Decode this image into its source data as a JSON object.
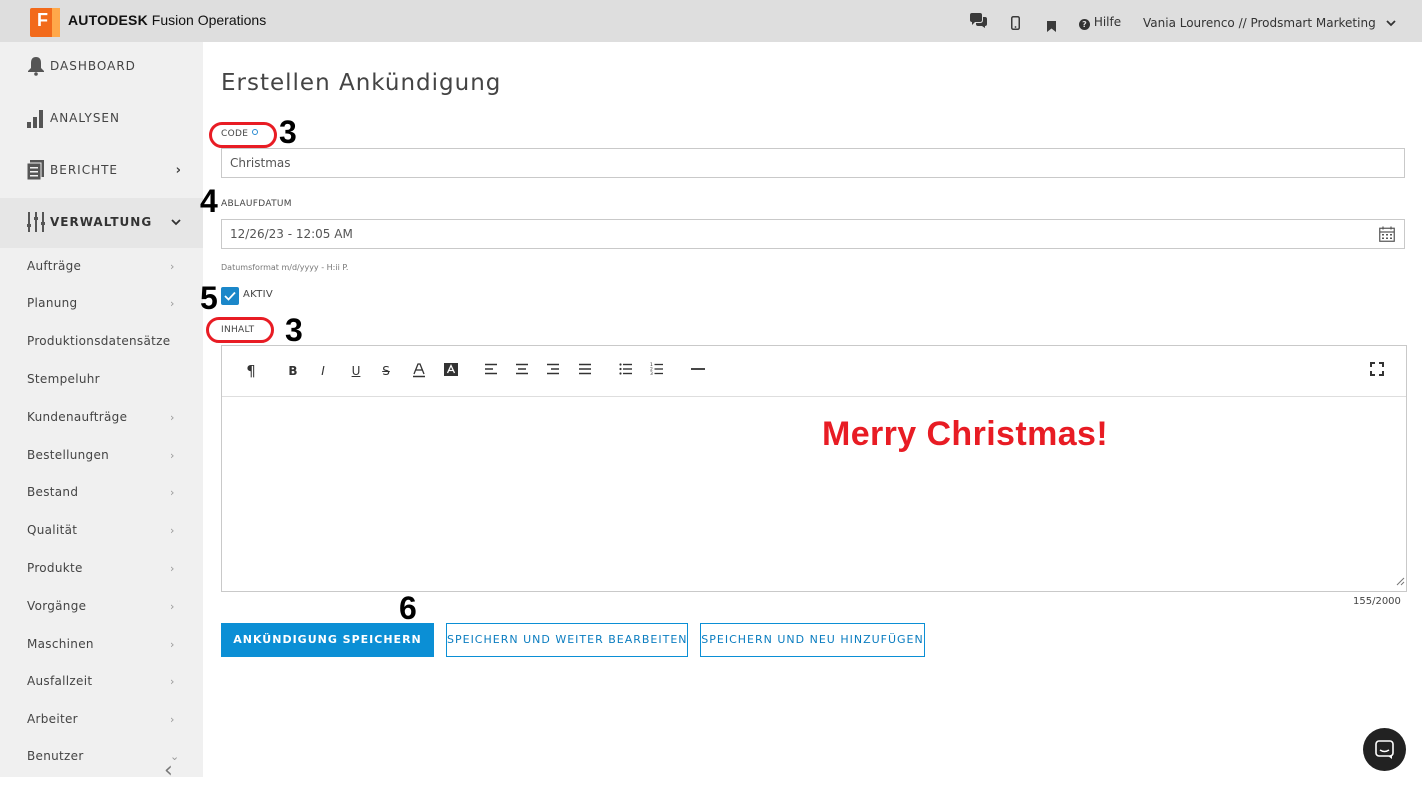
{
  "topbar": {
    "logo_letter": "F",
    "brand_bold": "AUTODESK",
    "brand_rest": " Fusion Operations",
    "help_label": "Hilfe",
    "user_name": "Vania Lourenco",
    "user_sep": " // ",
    "user_org": "Prodsmart Marketing"
  },
  "sidebar": {
    "main": [
      {
        "label": "DASHBOARD",
        "icon": "bell-icon"
      },
      {
        "label": "ANALYSEN",
        "icon": "bar-chart-icon"
      },
      {
        "label": "BERICHTE",
        "icon": "report-icon"
      },
      {
        "label": "VERWALTUNG",
        "icon": "sliders-icon"
      }
    ],
    "sub": [
      {
        "label": "Aufträge",
        "chevron": "›"
      },
      {
        "label": "Planung",
        "chevron": "›"
      },
      {
        "label": "Produktionsdatensätze",
        "chevron": ""
      },
      {
        "label": "Stempeluhr",
        "chevron": ""
      },
      {
        "label": "Kundenaufträge",
        "chevron": "›"
      },
      {
        "label": "Bestellungen",
        "chevron": "›"
      },
      {
        "label": "Bestand",
        "chevron": "›"
      },
      {
        "label": "Qualität",
        "chevron": "›"
      },
      {
        "label": "Produkte",
        "chevron": "›"
      },
      {
        "label": "Vorgänge",
        "chevron": "›"
      },
      {
        "label": "Maschinen",
        "chevron": "›"
      },
      {
        "label": "Ausfallzeit",
        "chevron": "›"
      },
      {
        "label": "Arbeiter",
        "chevron": "›"
      },
      {
        "label": "Benutzer",
        "chevron": "⌄"
      }
    ],
    "collapse_glyph": "‹"
  },
  "form": {
    "title": "Erstellen Ankündigung",
    "code_label": "CODE",
    "code_value": "Christmas",
    "expiry_label": "ABLAUFDATUM",
    "expiry_value": "12/26/23 - 12:05 AM",
    "date_hint": "Datumsformat m/d/yyyy - H:ii P.",
    "active_label": "AKTIV",
    "active_checked": true,
    "content_label": "INHALT",
    "content_text": "Merry Christmas!",
    "content_color": "#e81c24",
    "char_count": "155/2000"
  },
  "toolbar_tools": [
    "¶",
    "B",
    "I",
    "U",
    "S"
  ],
  "buttons": {
    "save": "ANKÜNDIGUNG SPEICHERN",
    "save_continue": "SPEICHERN UND WEITER BEARBEITEN",
    "save_new": "SPEICHERN UND NEU HINZUFÜGEN"
  },
  "annotations": {
    "code": "3",
    "expiry": "4",
    "active": "5",
    "content": "3",
    "save": "6"
  },
  "colors": {
    "accent": "#0b8fd5",
    "annotation_ring": "#e81c24",
    "topbar": "#dedede",
    "sidebar": "#f0f0f0"
  }
}
